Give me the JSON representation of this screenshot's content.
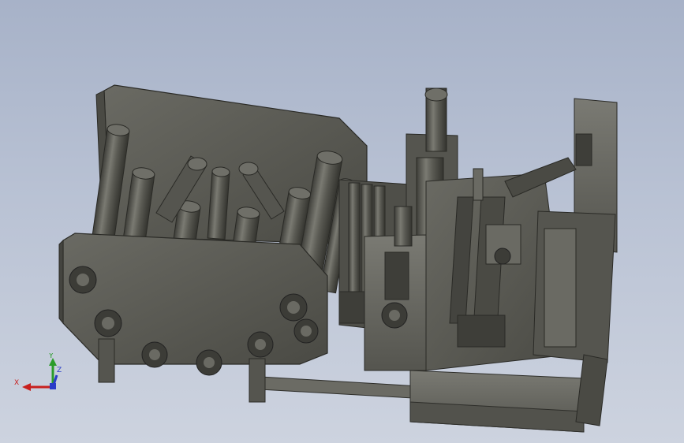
{
  "viewport": {
    "background_top": "#a7b2c8",
    "background_bottom": "#cdd3df"
  },
  "model": {
    "body_color": "#5f5f58",
    "dark_color": "#3a3a36",
    "light_color": "#8a8a82"
  },
  "triad": {
    "x_label": "X",
    "y_label": "Y",
    "z_label": "Z",
    "x_color": "#c8201e",
    "y_color": "#2a9c2a",
    "z_color": "#2a3cc8"
  }
}
